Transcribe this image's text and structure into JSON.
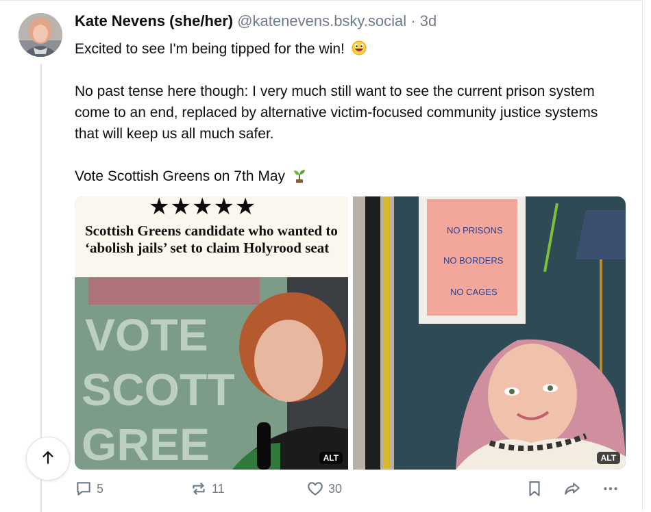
{
  "post": {
    "author_name": "Kate Nevens (she/her)",
    "author_handle": "@katenevens.bsky.social",
    "separator": "·",
    "time_ago": "3d",
    "text_line1": "Excited to see I'm being tipped for the win!",
    "text_para2": "No past tense here though: I very much still want to see the current prison system come to an end, replaced by alternative victim-focused community justice systems that will keep us all much safer.",
    "text_line3": "Vote Scottish Greens on 7th May",
    "emoji1": "grinning-face-emoji",
    "emoji2": "seedling-emoji"
  },
  "images": [
    {
      "stars": "★★★★★",
      "headline": "Scottish Greens candidate who wanted to ‘abolish jails’ set to claim Holyrood seat",
      "background_text": "VOTE SCOTTISH GREENS",
      "alt_label": "ALT"
    },
    {
      "poster_lines": [
        "NO PRISONS",
        "NO BORDERS",
        "NO CAGES"
      ],
      "alt_label": "ALT"
    }
  ],
  "actions": {
    "reply_count": "5",
    "repost_count": "11",
    "like_count": "30"
  },
  "icons": {
    "reply": "reply-icon",
    "repost": "repost-icon",
    "like": "heart-icon",
    "bookmark": "bookmark-icon",
    "share": "share-icon",
    "more": "more-icon",
    "scroll_top": "arrow-up-icon"
  },
  "colors": {
    "text": "#0b0f14",
    "muted": "#6f7b88",
    "border": "#e4e8ec"
  }
}
